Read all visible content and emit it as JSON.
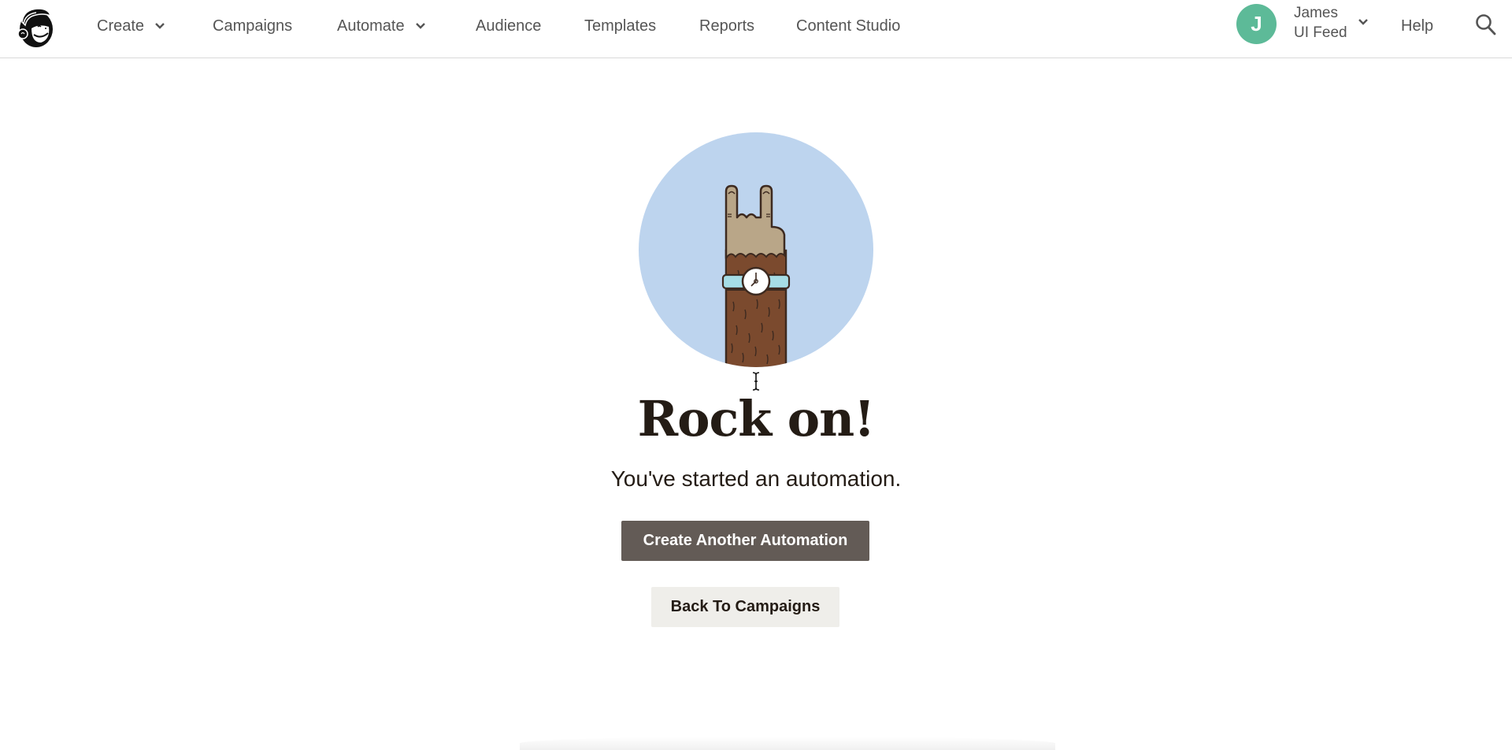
{
  "header": {
    "logo": "mailchimp-freddie-logo",
    "nav": [
      {
        "label": "Create",
        "has_dropdown": true
      },
      {
        "label": "Campaigns",
        "has_dropdown": false
      },
      {
        "label": "Automate",
        "has_dropdown": true
      },
      {
        "label": "Audience",
        "has_dropdown": false
      },
      {
        "label": "Templates",
        "has_dropdown": false
      },
      {
        "label": "Reports",
        "has_dropdown": false
      },
      {
        "label": "Content Studio",
        "has_dropdown": false
      }
    ],
    "account": {
      "avatar_initial": "J",
      "avatar_color": "#5dba98",
      "name": "James",
      "org": "UI Feed"
    },
    "help_label": "Help",
    "search_icon": "search-icon"
  },
  "main": {
    "illustration": "rock-on-hand-with-watch",
    "title": "Rock on!",
    "subtitle": "You've started an automation.",
    "primary_button": "Create Another Automation",
    "secondary_button": "Back To Campaigns"
  },
  "colors": {
    "primary_button_bg": "#635b56",
    "secondary_button_bg": "#efeeea",
    "illustration_bg": "#bdd4ee"
  }
}
